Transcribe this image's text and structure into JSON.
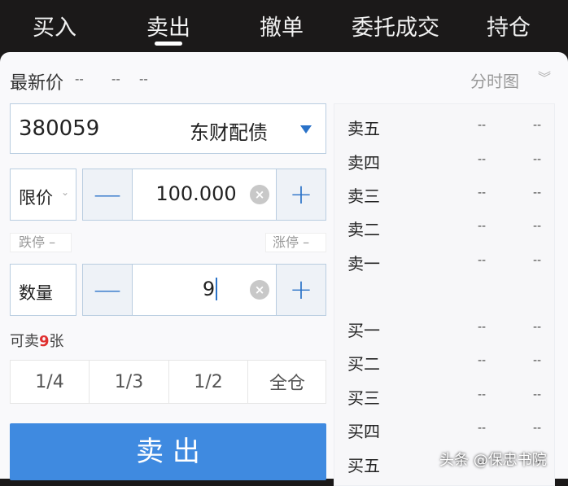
{
  "tabs": [
    {
      "label": "买入"
    },
    {
      "label": "卖出"
    },
    {
      "label": "撤单"
    },
    {
      "label": "委托成交"
    },
    {
      "label": "持仓"
    }
  ],
  "active_tab": "卖出",
  "quote": {
    "label": "最新价",
    "v1": "--",
    "v2": "--",
    "v3": "--",
    "chart_link": "分时图"
  },
  "security": {
    "code": "380059",
    "name": "东财配债"
  },
  "price": {
    "type": "限价",
    "value": "100.000",
    "limit_down": "跌停 –",
    "limit_up": "涨停 –"
  },
  "quantity": {
    "label": "数量",
    "value": "9"
  },
  "available": {
    "prefix": "可卖",
    "count": "9",
    "suffix": "张"
  },
  "fractions": [
    "1/4",
    "1/3",
    "1/2",
    "全仓"
  ],
  "sell_button": "卖 出",
  "orderbook": {
    "asks": [
      {
        "label": "卖五",
        "price": "--",
        "vol": "--"
      },
      {
        "label": "卖四",
        "price": "--",
        "vol": "--"
      },
      {
        "label": "卖三",
        "price": "--",
        "vol": "--"
      },
      {
        "label": "卖二",
        "price": "--",
        "vol": "--"
      },
      {
        "label": "卖一",
        "price": "--",
        "vol": "--"
      }
    ],
    "bids": [
      {
        "label": "买一",
        "price": "--",
        "vol": "--"
      },
      {
        "label": "买二",
        "price": "--",
        "vol": "--"
      },
      {
        "label": "买三",
        "price": "--",
        "vol": "--"
      },
      {
        "label": "买四",
        "price": "--",
        "vol": "--"
      },
      {
        "label": "买五",
        "price": "--",
        "vol": "--"
      }
    ]
  },
  "watermark": "头条 @保忠书院",
  "colors": {
    "accent": "#3f8ae0",
    "highlight": "#e03030"
  }
}
